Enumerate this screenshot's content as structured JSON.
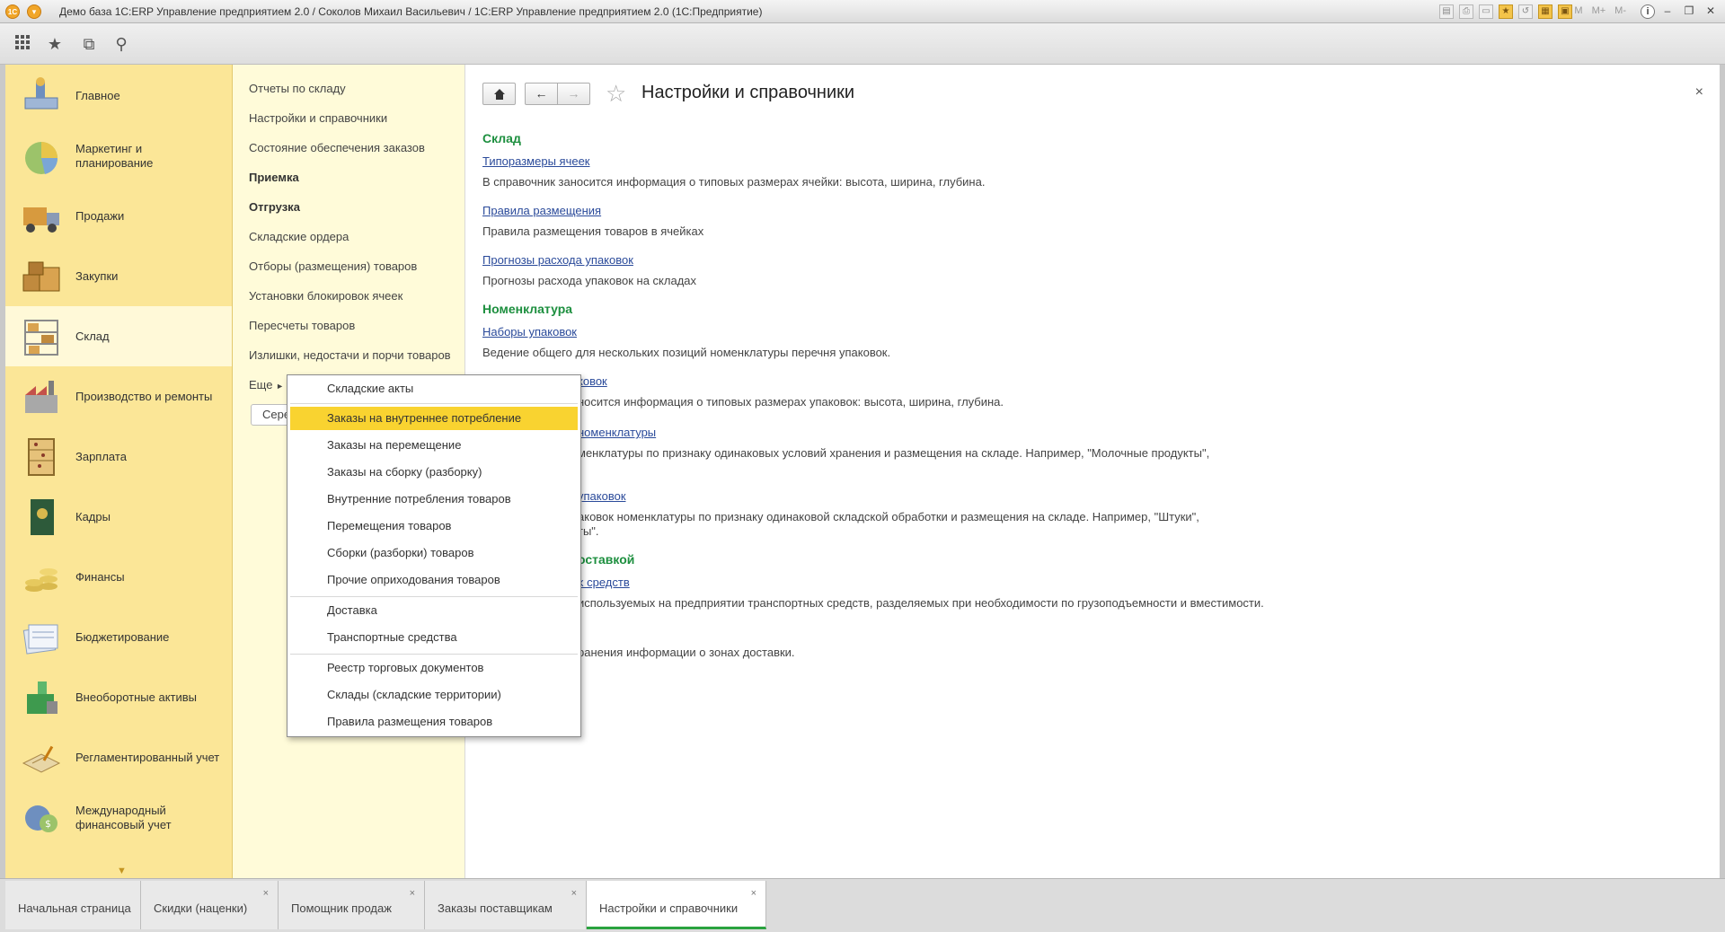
{
  "window": {
    "title": "Демо база 1C:ERP Управление предприятием 2.0 / Соколов Михаил Васильевич / 1C:ERP Управление предприятием 2.0  (1С:Предприятие)",
    "logo": "1С",
    "memory": [
      "M",
      "M+",
      "M-"
    ]
  },
  "sections": [
    {
      "label": "Главное",
      "icon": "home-desk-icon"
    },
    {
      "label": "Маркетинг и планирование",
      "icon": "pie-chart-icon"
    },
    {
      "label": "Продажи",
      "icon": "truck-icon"
    },
    {
      "label": "Закупки",
      "icon": "boxes-icon"
    },
    {
      "label": "Склад",
      "icon": "warehouse-shelf-icon",
      "active": true
    },
    {
      "label": "Производство и ремонты",
      "icon": "factory-icon"
    },
    {
      "label": "Зарплата",
      "icon": "abacus-icon"
    },
    {
      "label": "Кадры",
      "icon": "passport-icon"
    },
    {
      "label": "Финансы",
      "icon": "coins-icon"
    },
    {
      "label": "Бюджетирование",
      "icon": "documents-icon"
    },
    {
      "label": "Внеоборотные активы",
      "icon": "assets-icon"
    },
    {
      "label": "Регламентированный учет",
      "icon": "ledger-icon"
    },
    {
      "label": "Международный финансовый учет",
      "icon": "currency-icon"
    }
  ],
  "submenu": {
    "items": [
      {
        "label": "Отчеты по складу",
        "bold": false
      },
      {
        "label": "Настройки и справочники",
        "bold": false
      },
      {
        "label": "Состояние обеспечения заказов",
        "bold": false
      },
      {
        "label": "Приемка",
        "bold": true
      },
      {
        "label": "Отгрузка",
        "bold": true
      },
      {
        "label": "Складские ордера",
        "bold": false
      },
      {
        "label": "Отборы (размещения) товаров",
        "bold": false
      },
      {
        "label": "Установки блокировок ячеек",
        "bold": false
      },
      {
        "label": "Пересчеты товаров",
        "bold": false
      },
      {
        "label": "Излишки, недостачи и порчи товаров",
        "bold": false
      }
    ],
    "more": "Еще",
    "service_button": "Сере"
  },
  "main": {
    "title": "Настройки и справочники",
    "close": "×",
    "groups": [
      {
        "heading": "Склад",
        "entries": [
          {
            "link": "Типоразмеры ячеек",
            "desc": "В справочник заносится информация о типовых размерах ячейки: высота, ширина, глубина."
          },
          {
            "link": "Правила размещения",
            "desc": "Правила размещения товаров в ячейках"
          },
          {
            "link": "Прогнозы расхода упаковок",
            "desc": "Прогнозы расхода упаковок на складах"
          }
        ]
      },
      {
        "heading": "Номенклатура",
        "entries": [
          {
            "link": "Наборы упаковок",
            "desc": "Ведение общего для нескольких позиций номенклатуры перечня упаковок."
          }
        ]
      }
    ],
    "partial": {
      "link1": "ковок",
      "desc1": "носится информация о типовых размерах упаковок: высота, ширина, глубина.",
      "link2": " номенклатуры",
      "desc2": "менклатуры по признаку одинаковых условий хранения и размещения на складе. Например, \"Молочные продукты\",",
      "link3": " упаковок",
      "desc3a": "аковок номенклатуры по признаку одинаковой складской обработки и размещения на складе. Например, \"Штуки\",",
      "desc3b": "ты\".",
      "heading3": "оставкой",
      "link4": "х средств",
      "desc4": "используемых на предприятии транспортных средств, разделяемых при необходимости по грузоподъемности и вместимости.",
      "desc5": "ранения информации о зонах доставки."
    }
  },
  "popup": {
    "groups": [
      [
        "Складские акты"
      ],
      [
        "Заказы на внутреннее потребление",
        "Заказы на перемещение",
        "Заказы на сборку (разборку)",
        "Внутренние потребления товаров",
        "Перемещения товаров",
        "Сборки (разборки) товаров",
        "Прочие оприходования товаров"
      ],
      [
        "Доставка",
        "Транспортные средства"
      ],
      [
        "Реестр торговых документов",
        "Склады (складские территории)",
        "Правила размещения товаров"
      ]
    ],
    "highlighted": "Заказы на внутреннее потребление"
  },
  "tabs": [
    {
      "label": "Начальная страница",
      "closable": false
    },
    {
      "label": "Скидки (наценки)",
      "closable": true
    },
    {
      "label": "Помощник продаж",
      "closable": true
    },
    {
      "label": "Заказы поставщикам",
      "closable": true
    },
    {
      "label": "Настройки и справочники",
      "closable": true,
      "active": true
    }
  ],
  "colors": {
    "accent_green": "#1d8f3f",
    "highlight_yellow": "#f9d330",
    "sections_bg": "#fbe697",
    "link_blue": "#2a4a9a"
  }
}
